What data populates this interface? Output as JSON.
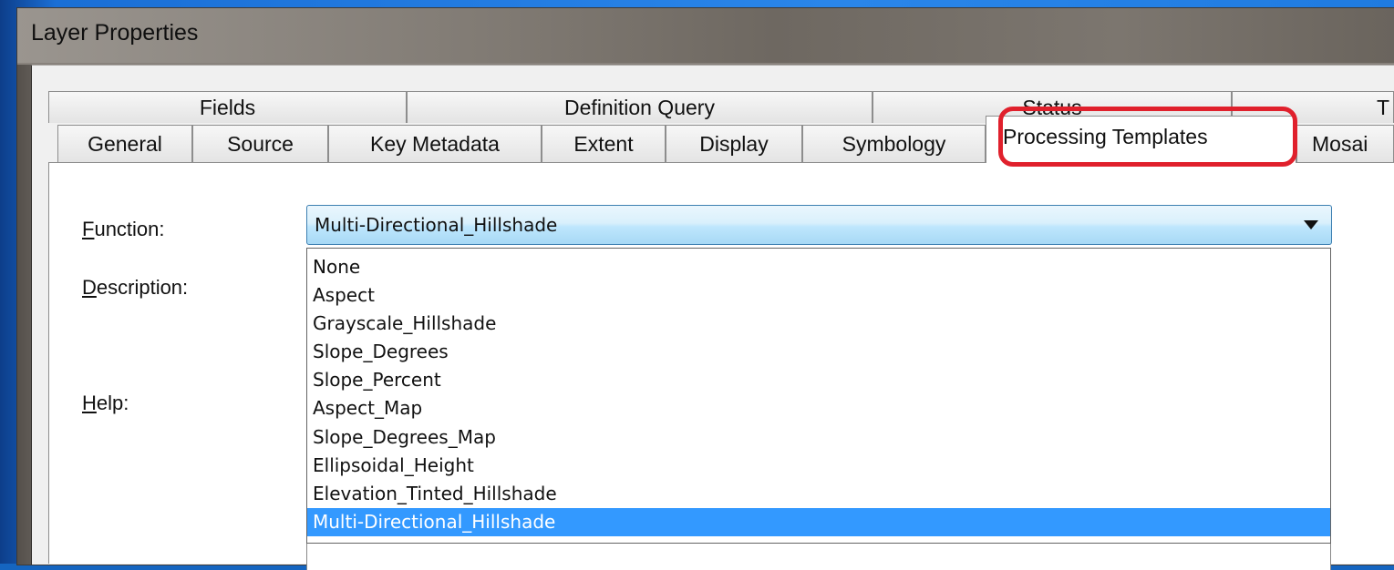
{
  "window": {
    "title": "Layer Properties"
  },
  "tabs_row1": [
    {
      "label": "Fields"
    },
    {
      "label": "Definition Query"
    },
    {
      "label": "Status"
    },
    {
      "label": "T"
    }
  ],
  "tabs_row2": [
    {
      "label": "General"
    },
    {
      "label": "Source"
    },
    {
      "label": "Key Metadata"
    },
    {
      "label": "Extent"
    },
    {
      "label": "Display"
    },
    {
      "label": "Symbology"
    },
    {
      "label": "Processing Templates",
      "selected": true
    },
    {
      "label": "Mosai"
    }
  ],
  "form": {
    "function_label_first": "F",
    "function_label_rest": "unction:",
    "description_label_first": "D",
    "description_label_rest": "escription:",
    "help_label_first": "H",
    "help_label_rest": "elp:"
  },
  "function_combo": {
    "value": "Multi-Directional_Hillshade",
    "options": [
      "None",
      "Aspect",
      "Grayscale_Hillshade",
      "Slope_Degrees",
      "Slope_Percent",
      "Aspect_Map",
      "Slope_Degrees_Map",
      "Ellipsoidal_Height",
      "Elevation_Tinted_Hillshade",
      "Multi-Directional_Hillshade"
    ],
    "selected_index": 9
  },
  "annotation": {
    "highlight_color": "#e0202c"
  },
  "colors": {
    "selection": "#3399ff",
    "desktop": "#1f7be0"
  }
}
